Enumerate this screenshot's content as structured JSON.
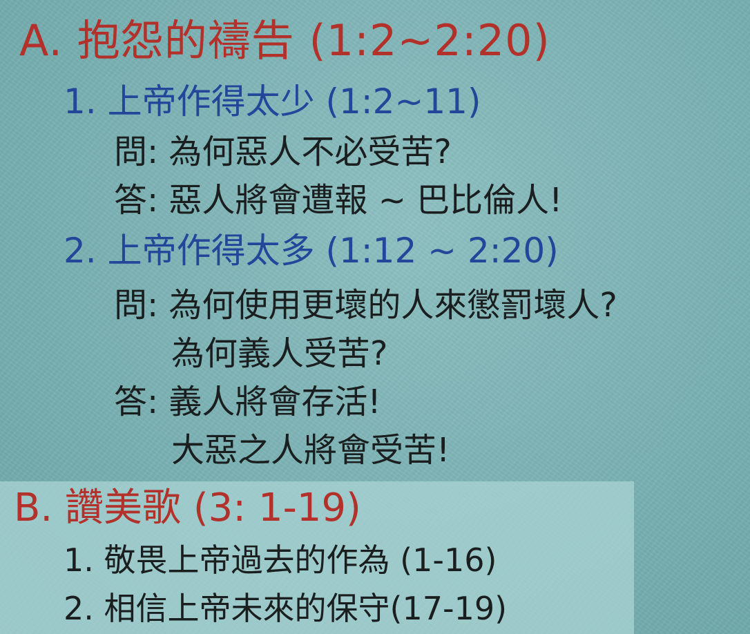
{
  "section_a": {
    "heading": "A. 抱怨的禱告 (1:2~2:20)",
    "point1": {
      "title": "1. 上帝作得太少 (1:2~11)",
      "question": "問: 為何惡人不必受苦?",
      "answer": "答: 惡人將會遭報 ~ 巴比倫人!"
    },
    "point2": {
      "title": "2. 上帝作得太多 (1:12 ~ 2:20)",
      "question_line1": "問: 為何使用更壞的人來懲罰壞人?",
      "question_line2": "為何義人受苦?",
      "answer_line1": "答: 義人將會存活!",
      "answer_line2": "大惡之人將會受苦!"
    }
  },
  "section_b": {
    "heading": "B. 讚美歌 (3: 1-19)",
    "items": [
      "1. 敬畏上帝過去的作為 (1-16)",
      "2. 相信上帝未來的保守(17-19)"
    ]
  },
  "colors": {
    "background": "#7eb4b6",
    "heading_red": "#b2322b",
    "subheading_blue": "#23469a",
    "body_text": "#1b1e1f",
    "section_b_highlight": "#a9d3d3"
  }
}
